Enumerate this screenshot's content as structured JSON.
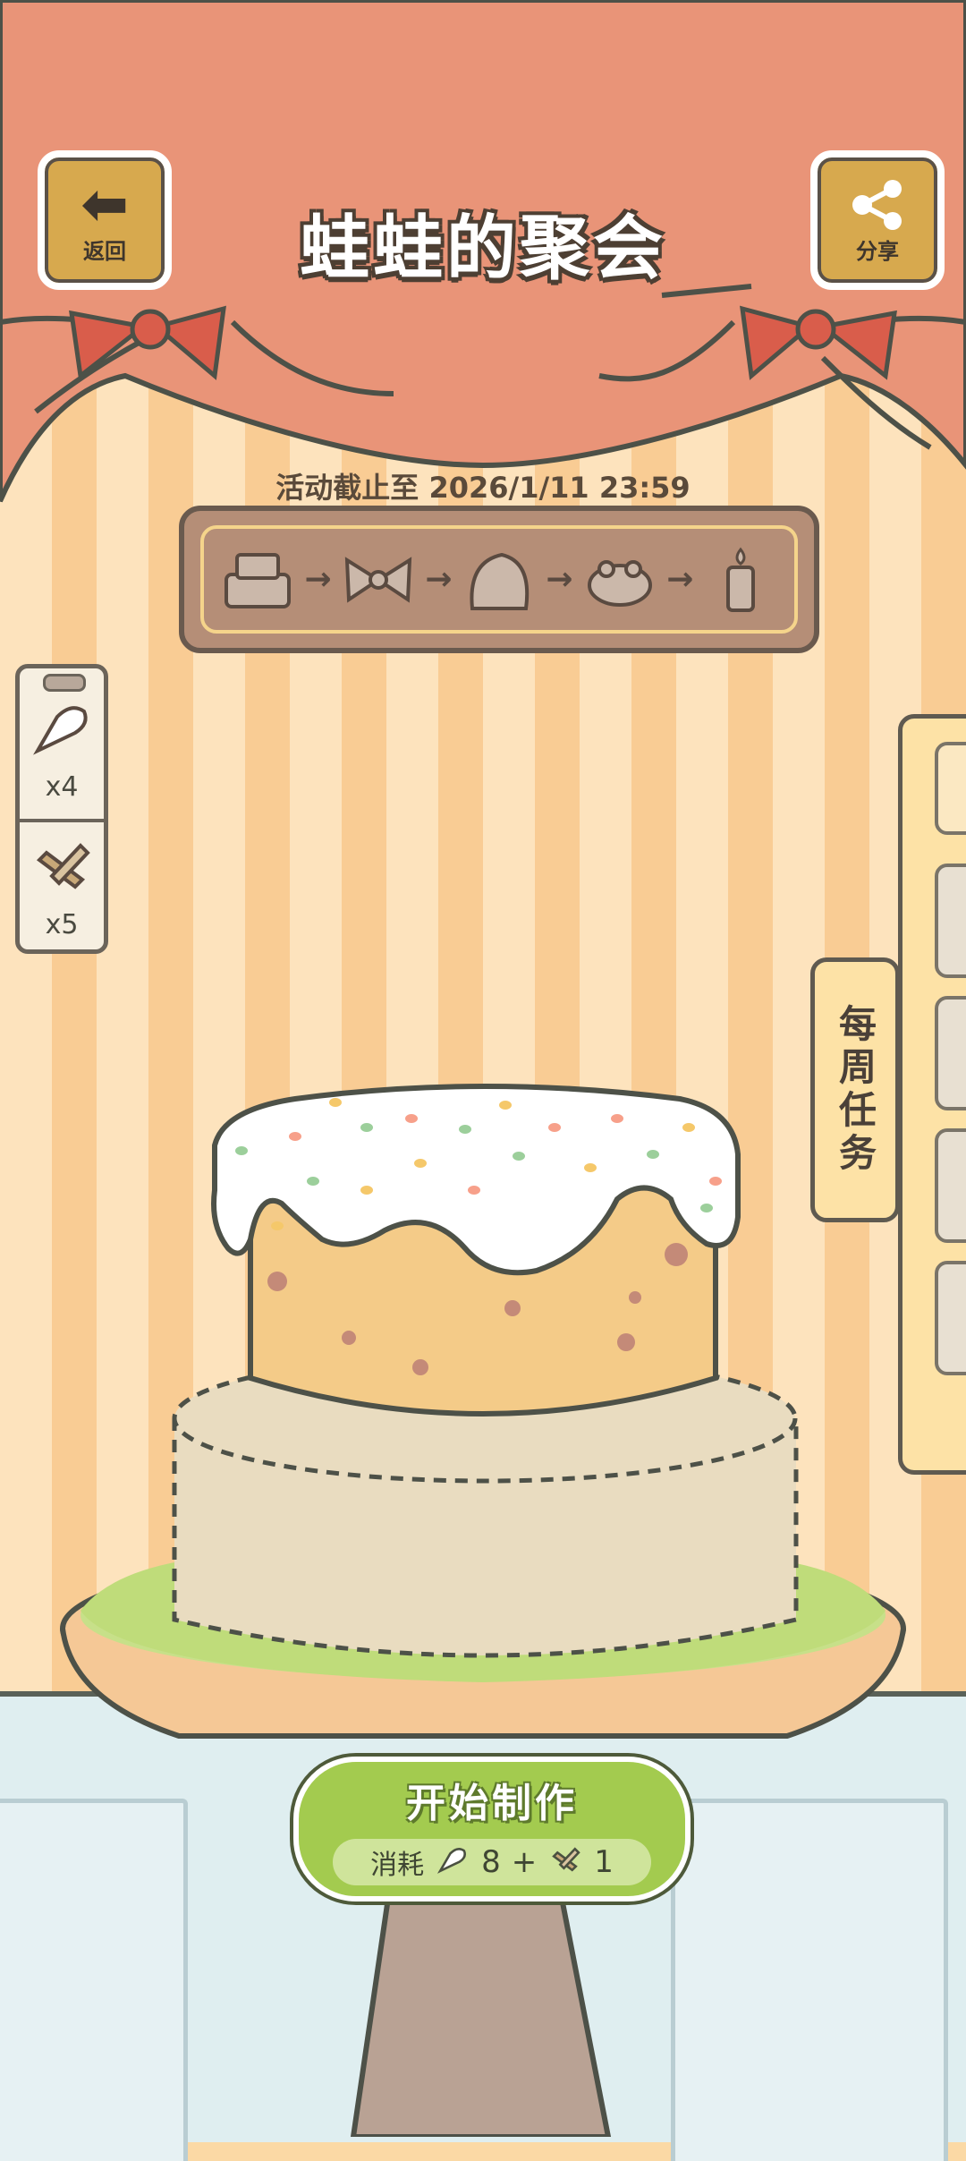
{
  "header": {
    "title": "蛙蛙的聚会",
    "back_label": "返回",
    "share_label": "分享"
  },
  "event": {
    "deadline": "活动截止至 2026/1/11 23:59",
    "stages": [
      "cake-base-icon",
      "bow-icon",
      "cream-icon",
      "frog-icon",
      "candle-icon"
    ]
  },
  "inventory": [
    {
      "icon": "piping-bag-icon",
      "count": "x4"
    },
    {
      "icon": "spatula-tools-icon",
      "count": "x5"
    }
  ],
  "side_tab": {
    "weekly_tasks": "每周任务"
  },
  "action": {
    "start_label": "开始制作",
    "cost_label": "消耗",
    "cost_a": "8",
    "plus": "+",
    "cost_b": "1"
  },
  "colors": {
    "curtain": "#e99478",
    "bow": "#d95d4b",
    "button_green": "#a3cb4f",
    "frosting": "#ffffff",
    "cake_top": "#f4cb88",
    "cake_bottom_outline": "#e8dcc2"
  }
}
